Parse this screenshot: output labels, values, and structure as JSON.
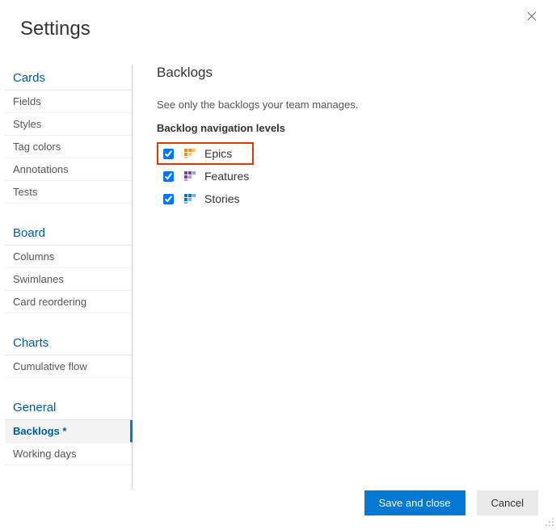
{
  "title": "Settings",
  "sidebar": {
    "sections": [
      {
        "header": "Cards",
        "items": [
          {
            "label": "Fields",
            "selected": false,
            "name": "sidebar-item-fields"
          },
          {
            "label": "Styles",
            "selected": false,
            "name": "sidebar-item-styles"
          },
          {
            "label": "Tag colors",
            "selected": false,
            "name": "sidebar-item-tag-colors"
          },
          {
            "label": "Annotations",
            "selected": false,
            "name": "sidebar-item-annotations"
          },
          {
            "label": "Tests",
            "selected": false,
            "name": "sidebar-item-tests"
          }
        ]
      },
      {
        "header": "Board",
        "items": [
          {
            "label": "Columns",
            "selected": false,
            "name": "sidebar-item-columns"
          },
          {
            "label": "Swimlanes",
            "selected": false,
            "name": "sidebar-item-swimlanes"
          },
          {
            "label": "Card reordering",
            "selected": false,
            "name": "sidebar-item-card-reordering"
          }
        ]
      },
      {
        "header": "Charts",
        "items": [
          {
            "label": "Cumulative flow",
            "selected": false,
            "name": "sidebar-item-cumulative-flow"
          }
        ]
      },
      {
        "header": "General",
        "items": [
          {
            "label": "Backlogs *",
            "selected": true,
            "name": "sidebar-item-backlogs"
          },
          {
            "label": "Working days",
            "selected": false,
            "name": "sidebar-item-working-days"
          }
        ]
      }
    ]
  },
  "main": {
    "title": "Backlogs",
    "description": "See only the backlogs your team manages.",
    "subheading": "Backlog navigation levels",
    "levels": [
      {
        "label": "Epics",
        "checked": true,
        "highlight": true,
        "icon_color": "#ff8c00",
        "name": "level-epics"
      },
      {
        "label": "Features",
        "checked": true,
        "highlight": false,
        "icon_color": "#773adc",
        "name": "level-features"
      },
      {
        "label": "Stories",
        "checked": true,
        "highlight": false,
        "icon_color": "#0078d4",
        "name": "level-stories"
      }
    ]
  },
  "footer": {
    "save_label": "Save and close",
    "cancel_label": "Cancel"
  }
}
